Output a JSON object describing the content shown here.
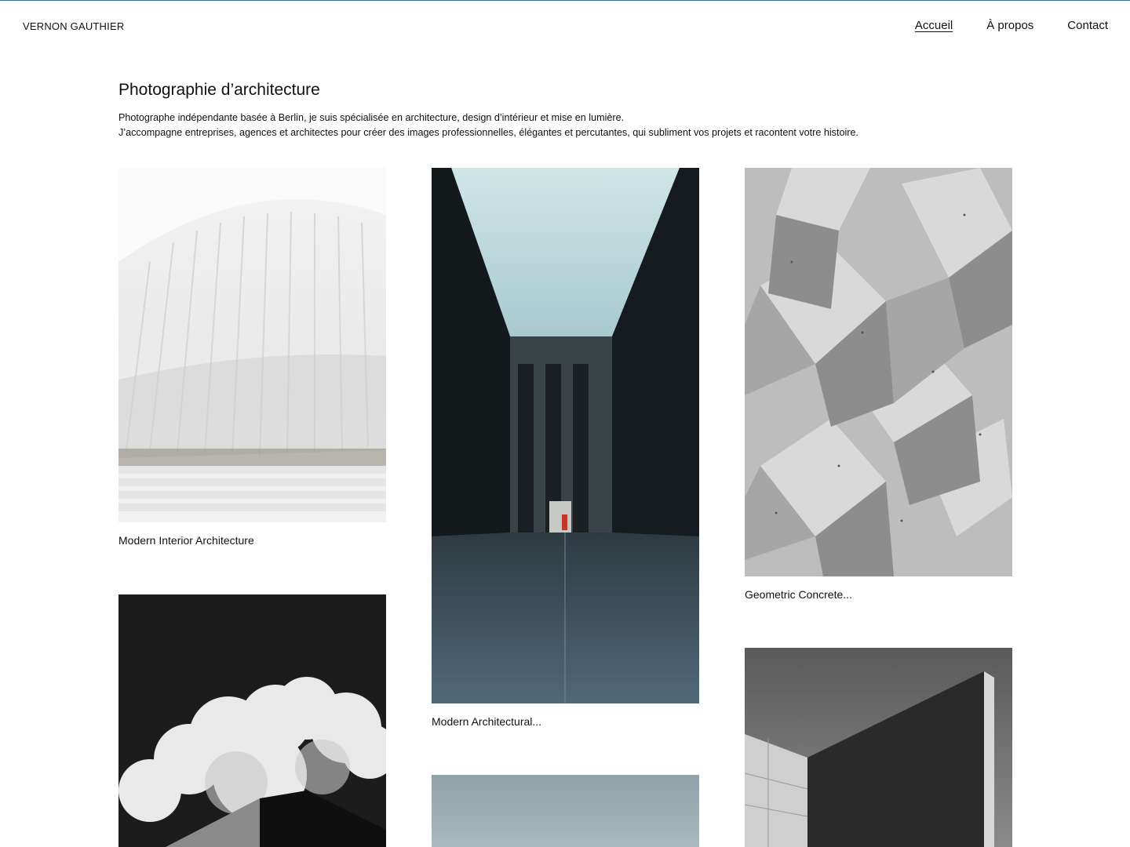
{
  "header": {
    "brand": "VERNON GAUTHIER",
    "nav": [
      {
        "label": "Accueil",
        "active": true
      },
      {
        "label": "À propos",
        "active": false
      },
      {
        "label": "Contact",
        "active": false
      }
    ]
  },
  "intro": {
    "title": "Photographie d’architecture",
    "line1": "Photographe indépendante basée à Berlin, je suis spécialisée en architecture, design d’intérieur et mise en lumière.",
    "line2": "J’accompagne entreprises, agences et architectes pour créer des images professionnelles, élégantes et percutantes, qui subliment vos projets et racontent votre histoire."
  },
  "gallery": {
    "items": [
      {
        "caption": "Modern Interior Architecture"
      },
      {
        "caption": "Modern Architectural..."
      },
      {
        "caption": "Geometric Concrete..."
      },
      {
        "caption": ""
      },
      {
        "caption": ""
      },
      {
        "caption": ""
      }
    ]
  },
  "colors": {
    "accent_line": "#3a6f8f",
    "text": "#111111",
    "background": "#ffffff"
  }
}
